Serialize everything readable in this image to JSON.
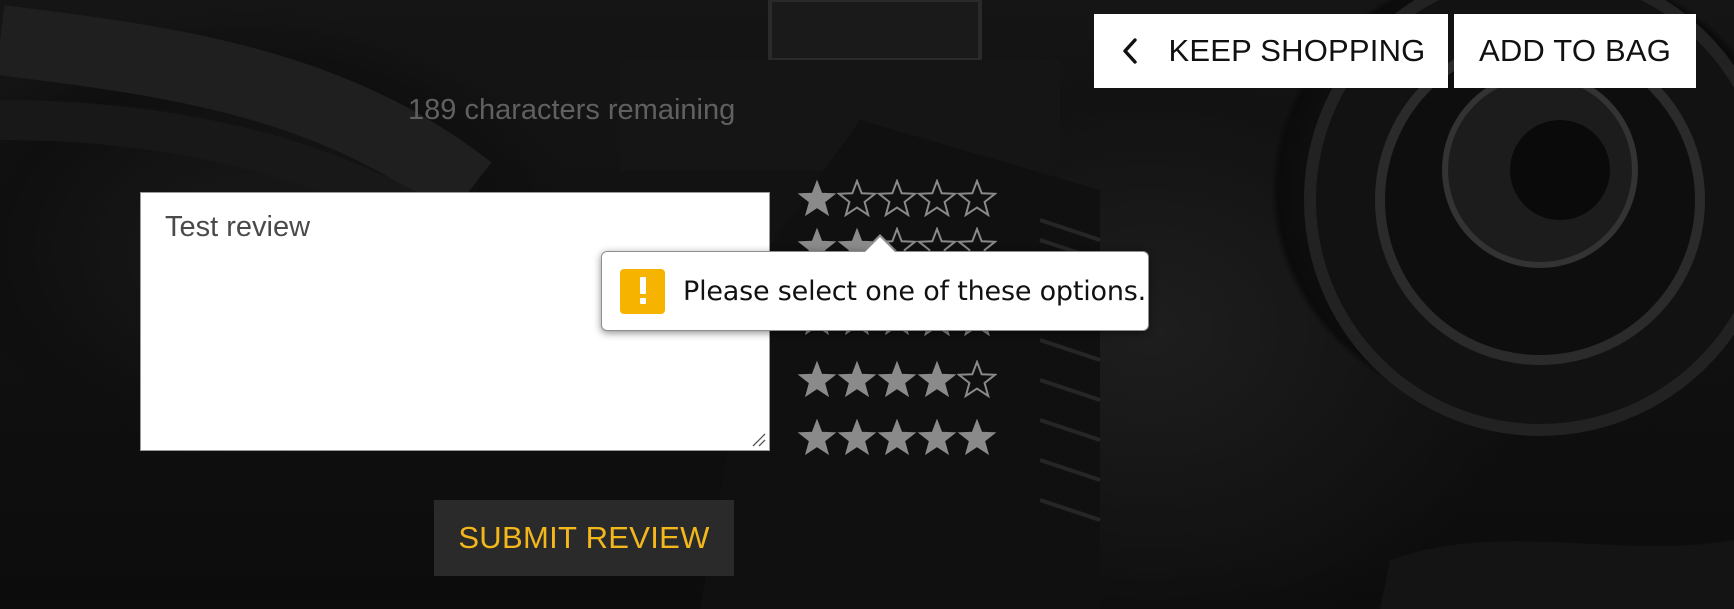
{
  "header": {
    "keep_shopping_label": "KEEP SHOPPING",
    "add_to_bag_label": "ADD TO BAG"
  },
  "review": {
    "characters_remaining": "189 characters remaining",
    "text_value": "Test review"
  },
  "rating": {
    "options": [
      {
        "filled": 1,
        "total": 5
      },
      {
        "filled": 2,
        "total": 5
      },
      {
        "filled": 3,
        "total": 5
      },
      {
        "filled": 4,
        "total": 5
      },
      {
        "filled": 5,
        "total": 5
      }
    ],
    "star_color": "#8a8a8a"
  },
  "validation": {
    "message": "Please select one of these options.",
    "icon": "warning-icon",
    "icon_color": "#f6b400"
  },
  "submit": {
    "label": "SUBMIT REVIEW",
    "text_color": "#f3b71c"
  }
}
